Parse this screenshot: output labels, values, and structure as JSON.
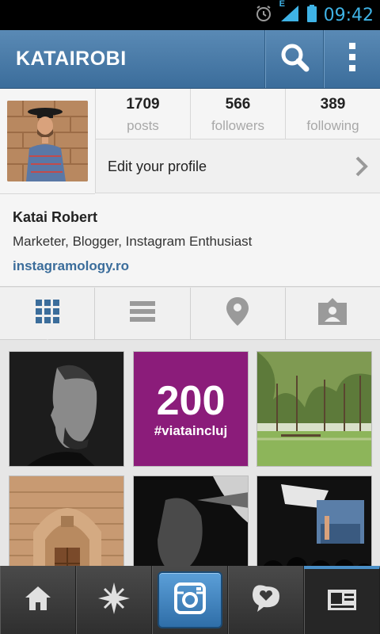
{
  "status_bar": {
    "time": "09:42",
    "network": "E",
    "icons": [
      "alarm-icon",
      "signal-icon",
      "battery-icon"
    ]
  },
  "header": {
    "username": "KATAIROBI",
    "icons": [
      "search-icon",
      "overflow-menu-icon"
    ]
  },
  "profile": {
    "stats": [
      {
        "value": "1709",
        "label": "posts"
      },
      {
        "value": "566",
        "label": "followers"
      },
      {
        "value": "389",
        "label": "following"
      }
    ],
    "edit_label": "Edit your profile",
    "full_name": "Katai Robert",
    "bio": "Marketer, Blogger, Instagram Enthusiast",
    "website": "instagramology.ro"
  },
  "view_tabs": [
    {
      "name": "grid-view-icon",
      "selected": true
    },
    {
      "name": "list-view-icon",
      "selected": false
    },
    {
      "name": "map-pin-icon",
      "selected": false
    },
    {
      "name": "tagged-photos-icon",
      "selected": false
    }
  ],
  "photos": [
    {
      "caption": "",
      "overlay_number": "",
      "overlay_tag": ""
    },
    {
      "caption": "",
      "overlay_number": "200",
      "overlay_tag": "#viataincluj"
    },
    {
      "caption": "",
      "overlay_number": "",
      "overlay_tag": ""
    }
  ],
  "bottom_nav": [
    "home-icon",
    "explore-icon",
    "camera-icon",
    "news-icon",
    "profile-icon"
  ],
  "colors": {
    "header_blue": "#3b6d9b",
    "link_blue": "#3b6d9b",
    "status_time": "#3fb3e6",
    "photo_purple": "#8b1c7a"
  }
}
